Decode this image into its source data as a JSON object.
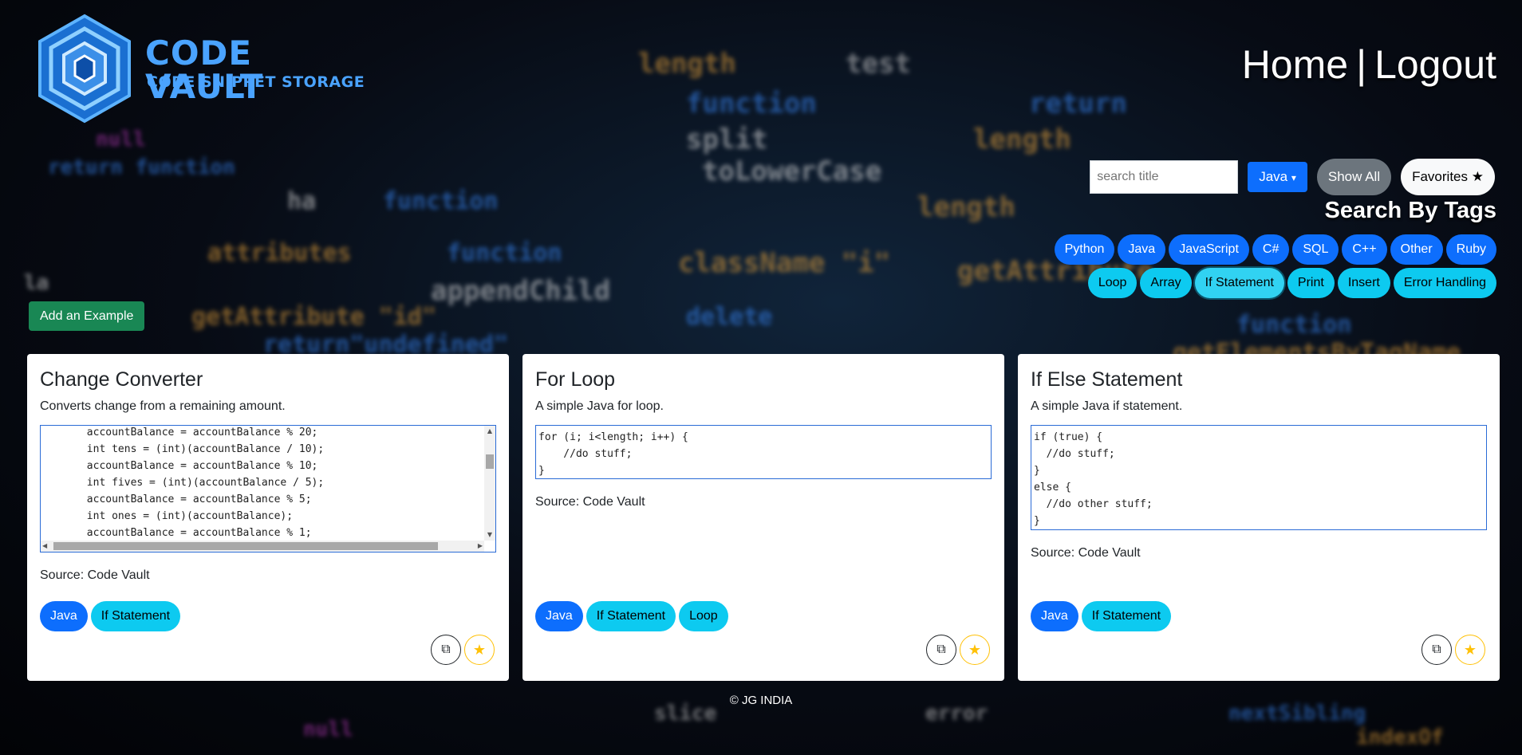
{
  "brand": {
    "title": "CODE VAULT",
    "subtitle": "CODE SNIPPET STORAGE"
  },
  "nav": {
    "home": "Home",
    "separator": "|",
    "logout": "Logout"
  },
  "search": {
    "placeholder": "search title",
    "language": "Java",
    "show_all": "Show All",
    "favorites": "Favorites"
  },
  "tags_title": "Search By Tags",
  "tags_row1": [
    "Python",
    "Java",
    "JavaScript",
    "C#",
    "SQL",
    "C++",
    "Other",
    "Ruby"
  ],
  "tags_row2": [
    "Loop",
    "Array",
    "If Statement",
    "Print",
    "Insert",
    "Error Handling"
  ],
  "add_button": "Add an Example",
  "cards": [
    {
      "title": "Change Converter",
      "description": "Converts change from a remaining amount.",
      "code": "       accountBalance = accountBalance % 20;\n       int tens = (int)(accountBalance / 10);\n       accountBalance = accountBalance % 10;\n       int fives = (int)(accountBalance / 5);\n       accountBalance = accountBalance % 5;\n       int ones = (int)(accountBalance);\n       accountBalance = accountBalance % 1;",
      "source": "Source: Code Vault",
      "tags": [
        "Java",
        "If Statement"
      ]
    },
    {
      "title": "For Loop",
      "description": "A simple Java for loop.",
      "code": "for (i; i<length; i++) {\n    //do stuff;\n}",
      "source": "Source: Code Vault",
      "tags": [
        "Java",
        "If Statement",
        "Loop"
      ]
    },
    {
      "title": "If Else Statement",
      "description": "A simple Java if statement.",
      "code": "if (true) {\n  //do stuff;\n}\nelse {\n  //do other stuff;\n}",
      "source": "Source: Code Vault",
      "tags": [
        "Java",
        "If Statement"
      ]
    }
  ],
  "footer": "© JG INDIA"
}
